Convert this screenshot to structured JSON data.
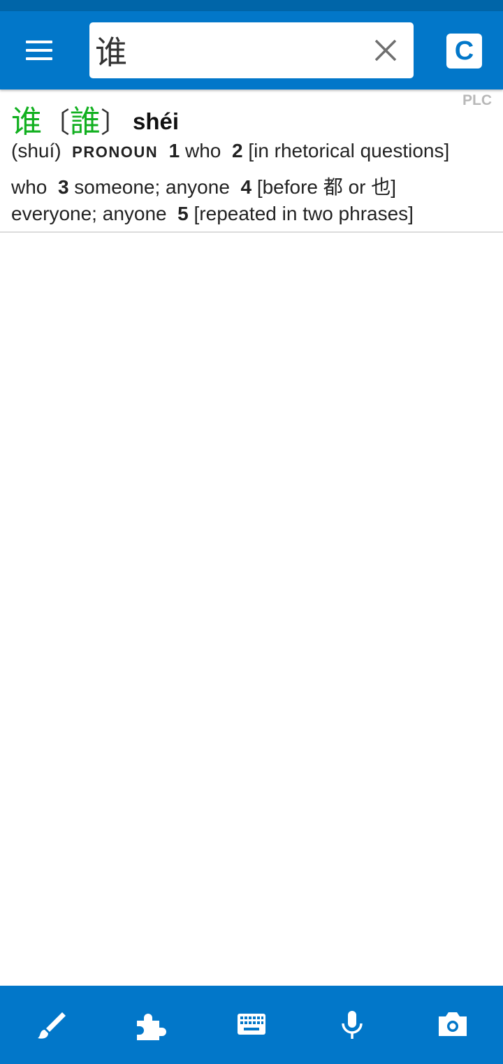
{
  "search": {
    "value": "谁"
  },
  "source_label": "PLC",
  "mode_button": "C",
  "entry": {
    "simplified": "谁",
    "bracket_open": "〔",
    "traditional": "誰",
    "bracket_close": "〕",
    "pinyin": "shéi",
    "line1": {
      "variant": "(shuí)",
      "pos": "PRONOUN",
      "n1": "1",
      "d1": "who",
      "n2": "2",
      "d2": "[in rhetorical questions]"
    },
    "line2": {
      "d2_cont": "who",
      "n3": "3",
      "d3": "someone; anyone",
      "n4": "4",
      "d4_pre": "[before",
      "d4_char1": "都",
      "d4_mid": "or",
      "d4_char2": "也",
      "d4_post": "]"
    },
    "line3": {
      "d4_cont": "everyone; anyone",
      "n5": "5",
      "d5": "[repeated in two phrases]"
    }
  },
  "bottom_tools": [
    "brush-icon",
    "puzzle-icon",
    "keyboard-icon",
    "microphone-icon",
    "camera-icon"
  ],
  "colors": {
    "primary": "#0277c9",
    "status_bar": "#0065a8",
    "headword": "#12b020"
  }
}
